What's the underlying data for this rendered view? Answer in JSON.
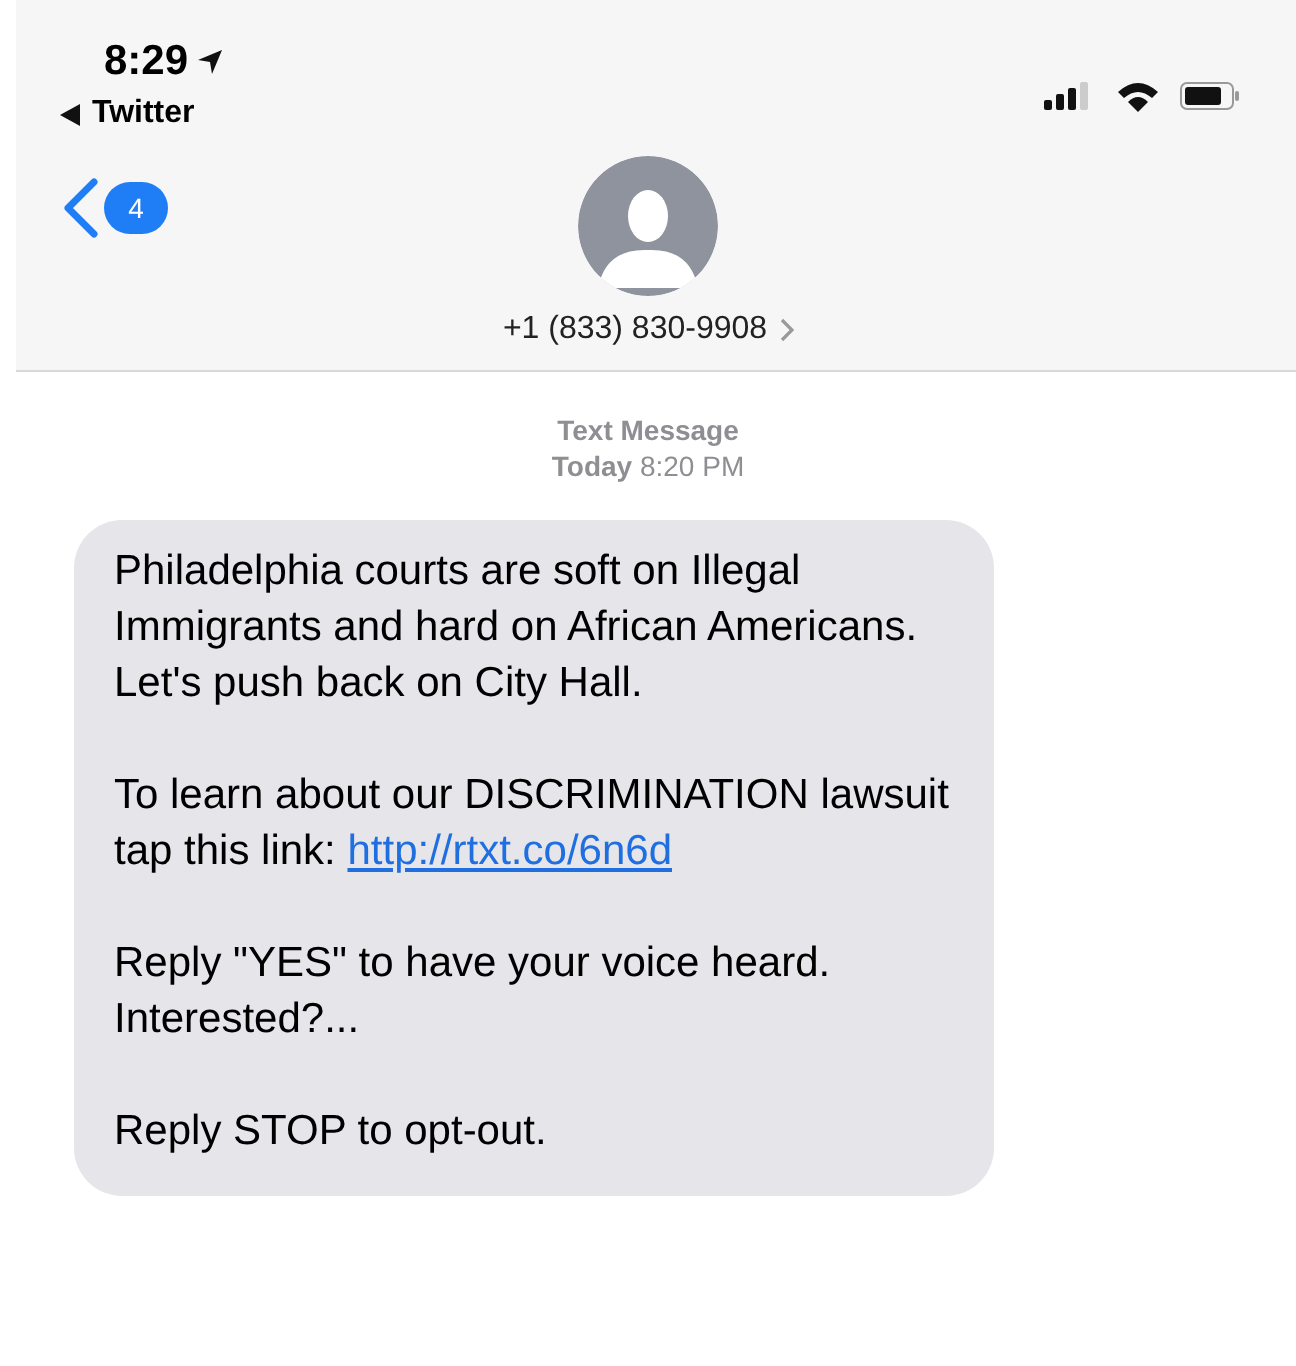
{
  "status_bar": {
    "time": "8:29",
    "back_app": "Twitter"
  },
  "header": {
    "unread_count": "4",
    "contact": "+1 (833) 830-9908"
  },
  "conversation": {
    "service": "Text Message",
    "timestamp": "**Today** 8:20 PM"
  },
  "message": {
    "paragraphs": [
      {
        "text": "Philadelphia courts are soft on Illegal Immigrants and hard on African Americans. Let's push back on City Hall."
      },
      {
        "text": "To learn about our DISCRIMINATION lawsuit tap this link:",
        "link": "http://rtxt.co/6n6d"
      },
      {
        "text": "Reply \"YES\" to have your voice heard. Interested?..."
      },
      {
        "text": "Reply STOP to opt-out."
      }
    ]
  }
}
